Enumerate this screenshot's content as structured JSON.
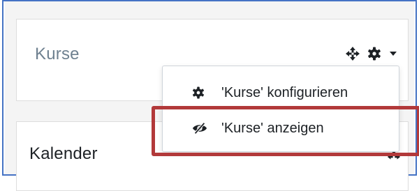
{
  "blocks": {
    "kurse": {
      "title": "Kurse",
      "icons": [
        "move-icon",
        "gear-icon",
        "caret-down-icon"
      ]
    },
    "kalender": {
      "title": "Kalender"
    }
  },
  "menu": {
    "items": [
      {
        "label": "'Kurse' konfigurieren",
        "icon": "gear-icon"
      },
      {
        "label": "'Kurse' anzeigen",
        "icon": "eye-slash-icon"
      }
    ]
  },
  "colors": {
    "highlight": "#b2393a",
    "frame": "#4472c4",
    "muted_title": "#6f8190",
    "text": "#1d2125"
  }
}
